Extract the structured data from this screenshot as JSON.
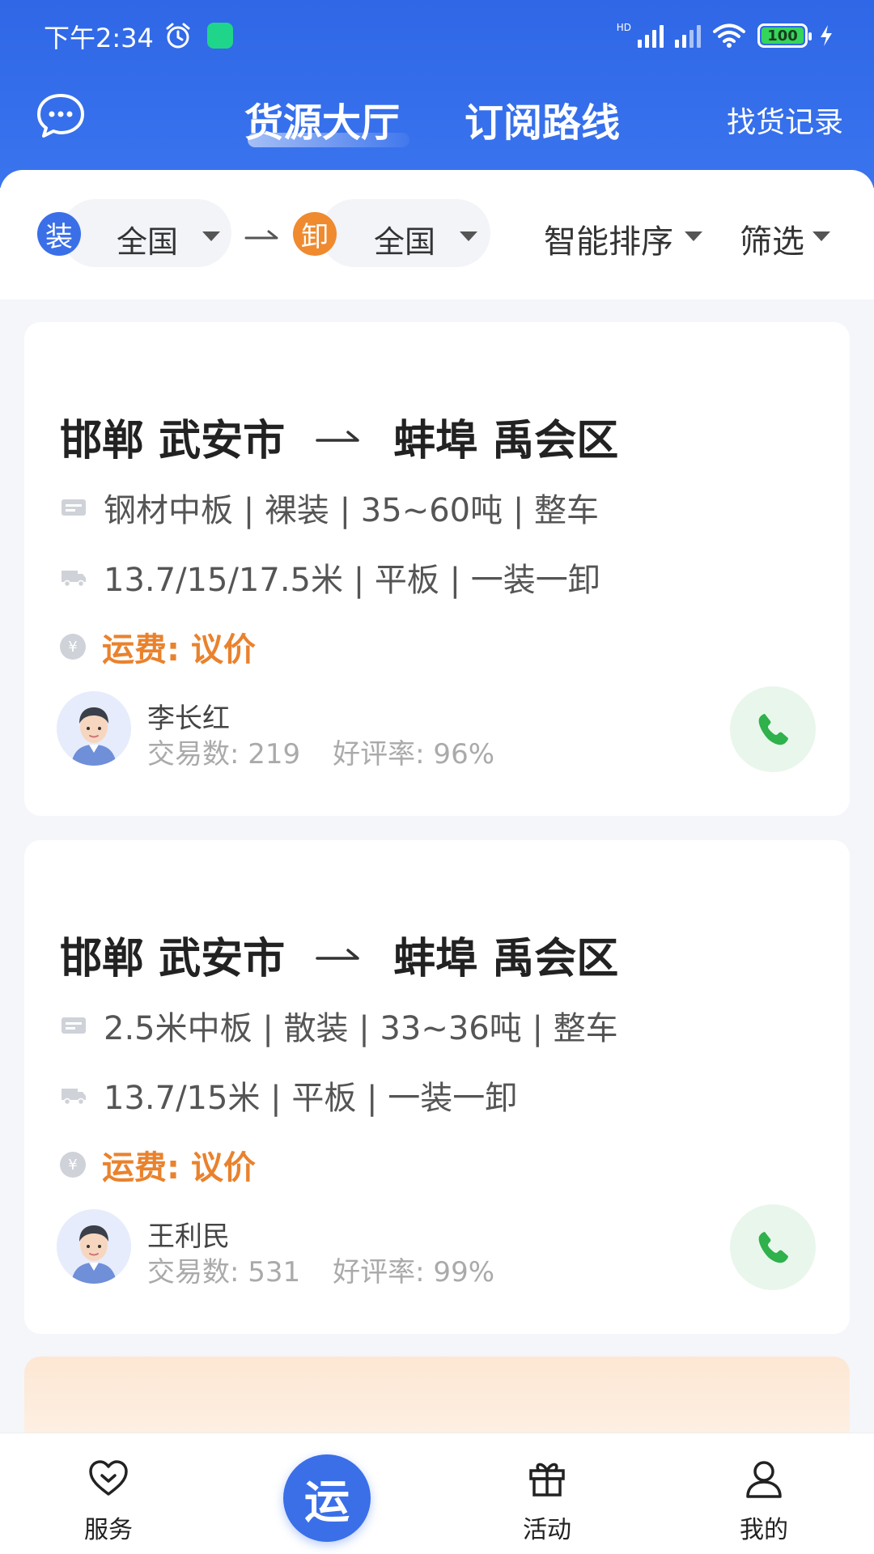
{
  "status_bar": {
    "time": "下午2:34",
    "battery": "100"
  },
  "header": {
    "tabs": [
      {
        "label": "货源大厅",
        "active": true
      },
      {
        "label": "订阅路线",
        "active": false
      }
    ],
    "history_label": "找货记录"
  },
  "filters": {
    "load_badge": "装",
    "load_value": "全国",
    "unload_badge": "卸",
    "unload_value": "全国",
    "sort_label": "智能排序",
    "filter_label": "筛选"
  },
  "cards": [
    {
      "from": "邯郸 武安市",
      "to": "蚌埠 禹会区",
      "cargo": "钢材中板 | 裸装 | 35~60吨 | 整车",
      "truck": "13.7/15/17.5米 | 平板 | 一装一卸",
      "fee": "运费: 议价",
      "shipper": "李长红",
      "deals": "交易数: 219",
      "rating": "好评率: 96%"
    },
    {
      "from": "邯郸 武安市",
      "to": "蚌埠 禹会区",
      "cargo": "2.5米中板 | 散装 | 33~36吨 | 整车",
      "truck": "13.7/15米 | 平板 | 一装一卸",
      "fee": "运费: 议价",
      "shipper": "王利民",
      "deals": "交易数: 531",
      "rating": "好评率: 99%"
    }
  ],
  "bottom_nav": {
    "service": "服务",
    "center": "运",
    "activity": "活动",
    "mine": "我的"
  },
  "colors": {
    "primary": "#3a6fe8",
    "unload_orange": "#ef8a2f",
    "fee_orange": "#e9822d",
    "call_green": "#2fb14c"
  }
}
